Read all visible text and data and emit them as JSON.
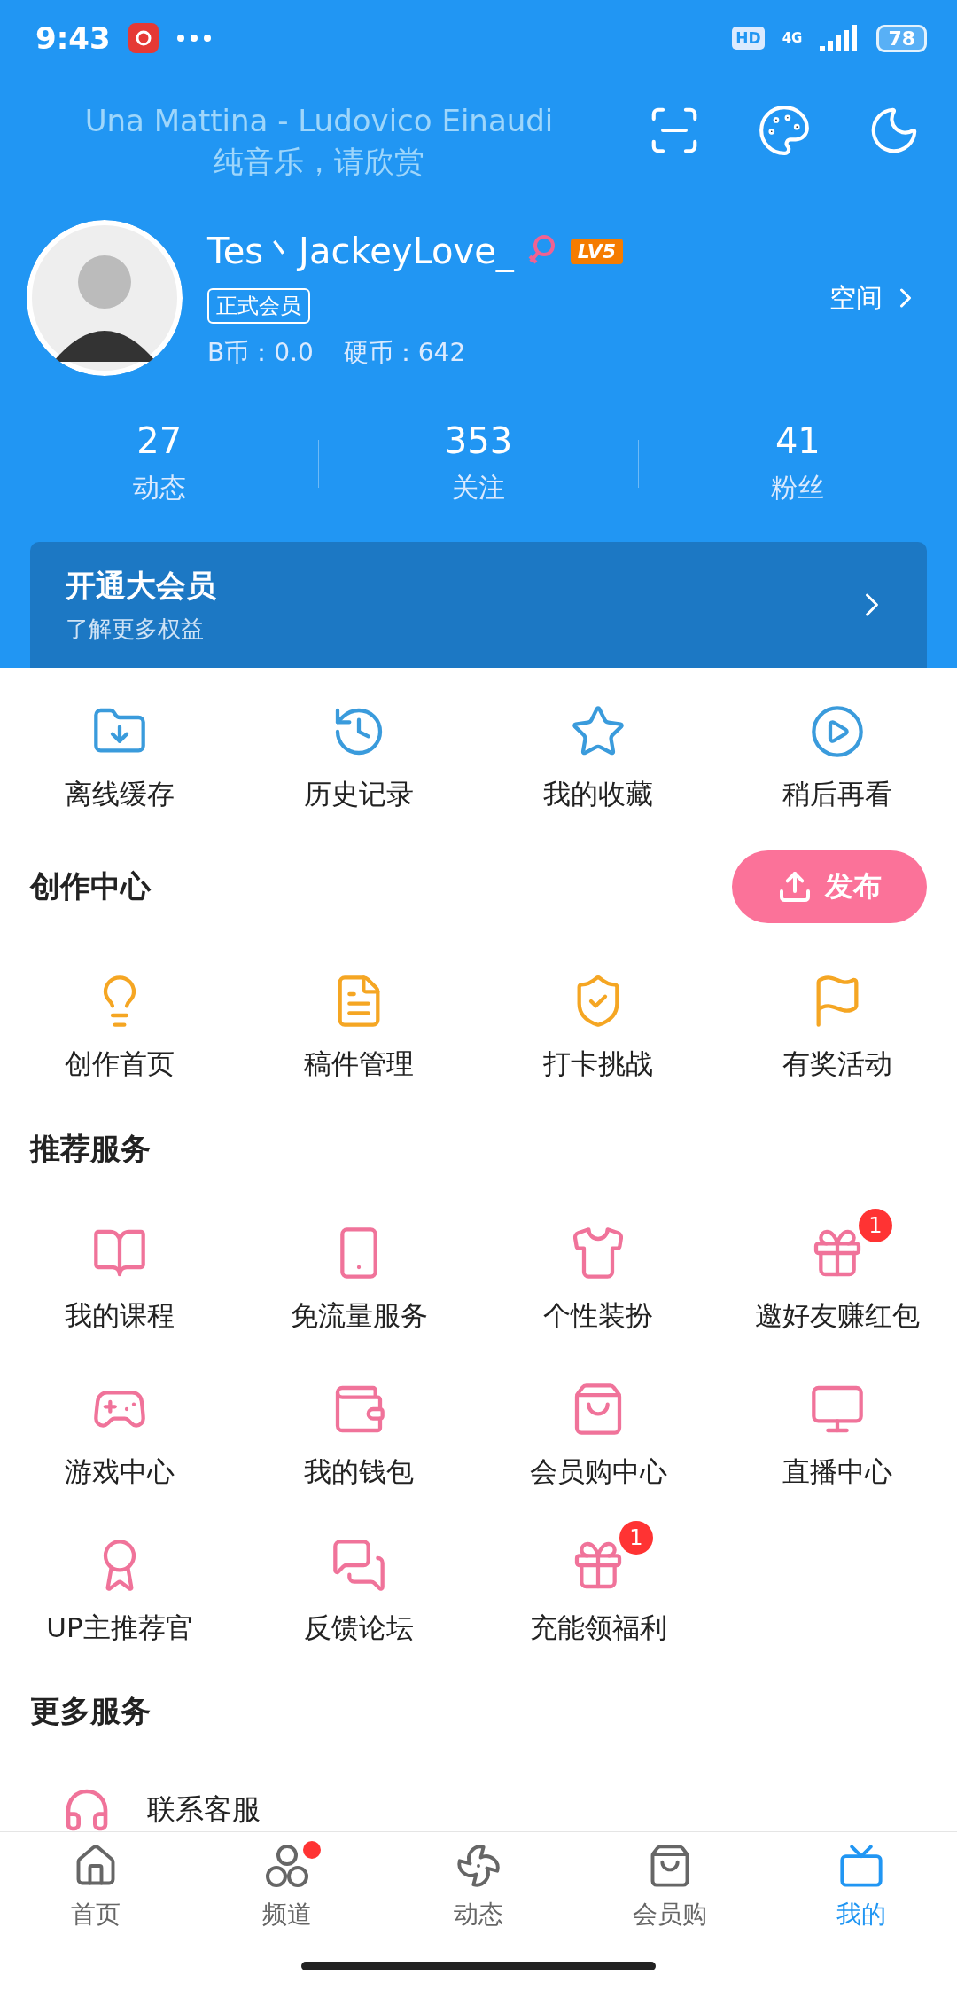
{
  "status_bar": {
    "time": "9:43",
    "battery": "78",
    "network": "4G",
    "hd": "HD"
  },
  "lyrics": {
    "title": "Una Mattina - Ludovico Einaudi",
    "line": "纯音乐，请欣赏"
  },
  "profile": {
    "name": "Tes丶JackeyLove_",
    "level": "LV5",
    "member_badge": "正式会员",
    "coins": "B币：0.0",
    "hard_coins": "硬币：642",
    "space_link": "空间"
  },
  "stats": [
    {
      "value": "27",
      "label": "动态"
    },
    {
      "value": "353",
      "label": "关注"
    },
    {
      "value": "41",
      "label": "粉丝"
    }
  ],
  "vip_card": {
    "title": "开通大会员",
    "subtitle": "了解更多权益"
  },
  "quick_actions": [
    {
      "label": "离线缓存"
    },
    {
      "label": "历史记录"
    },
    {
      "label": "我的收藏"
    },
    {
      "label": "稍后再看"
    }
  ],
  "creation": {
    "title": "创作中心",
    "publish_button": "发布",
    "items": [
      {
        "label": "创作首页"
      },
      {
        "label": "稿件管理"
      },
      {
        "label": "打卡挑战"
      },
      {
        "label": "有奖活动"
      }
    ]
  },
  "recommended": {
    "title": "推荐服务",
    "items": [
      {
        "label": "我的课程"
      },
      {
        "label": "免流量服务"
      },
      {
        "label": "个性装扮"
      },
      {
        "label": "邀好友赚红包",
        "badge": "1"
      },
      {
        "label": "游戏中心"
      },
      {
        "label": "我的钱包"
      },
      {
        "label": "会员购中心"
      },
      {
        "label": "直播中心"
      },
      {
        "label": "UP主推荐官"
      },
      {
        "label": "反馈论坛"
      },
      {
        "label": "充能领福利",
        "badge": "1"
      }
    ]
  },
  "more_services": {
    "title": "更多服务",
    "items": [
      {
        "label": "联系客服"
      }
    ]
  },
  "bottom_nav": [
    {
      "label": "首页",
      "selected": false,
      "dot": false
    },
    {
      "label": "频道",
      "selected": false,
      "dot": true
    },
    {
      "label": "动态",
      "selected": false,
      "dot": false
    },
    {
      "label": "会员购",
      "selected": false,
      "dot": false
    },
    {
      "label": "我的",
      "selected": true,
      "dot": false
    }
  ]
}
